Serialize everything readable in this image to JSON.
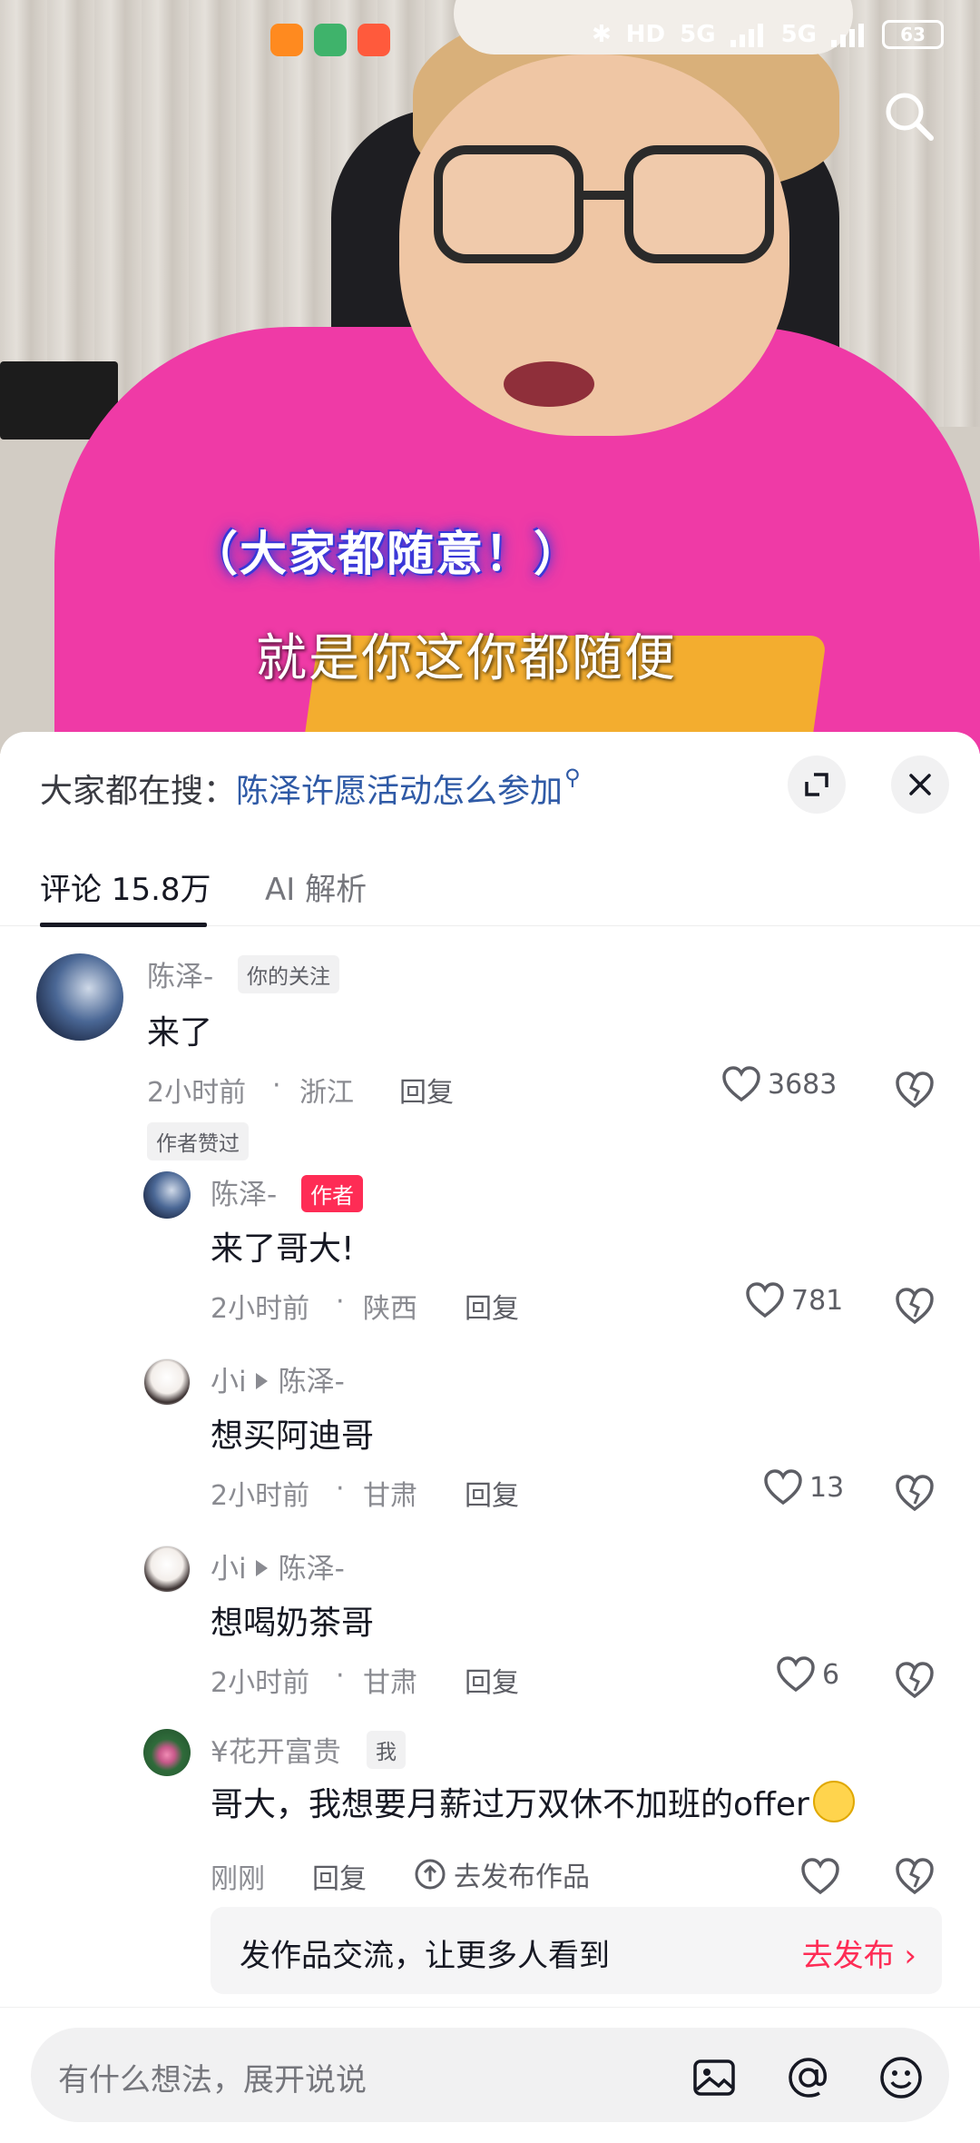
{
  "subtitles": {
    "line1": "（大家都随意！）",
    "line2": "就是你这你都随便"
  },
  "status_bar": {
    "battery": "63",
    "hd": "HD",
    "net1": "5G",
    "net2": "5G"
  },
  "suggest": {
    "label": "大家都在搜：",
    "query": "陈泽许愿活动怎么参加"
  },
  "tabs": {
    "comments": "评论 15.8万",
    "ai": "AI 解析"
  },
  "comments": [
    {
      "user": "陈泽-",
      "badge": "你的关注",
      "text": "来了",
      "time": "2小时前",
      "location": "浙江",
      "reply": "回复",
      "likes": "3683",
      "extra_tag": "作者赞过"
    },
    {
      "user": "陈泽-",
      "badge": "作者",
      "text": "来了哥大!",
      "time": "2小时前",
      "location": "陕西",
      "reply": "回复",
      "likes": "781"
    },
    {
      "user": "小i",
      "reply_to": "陈泽-",
      "text": "想买阿迪哥",
      "time": "2小时前",
      "location": "甘肃",
      "reply": "回复",
      "likes": "13"
    },
    {
      "user": "小i",
      "reply_to": "陈泽-",
      "text": "想喝奶茶哥",
      "time": "2小时前",
      "location": "甘肃",
      "reply": "回复",
      "likes": "6"
    },
    {
      "user": "¥花开富贵",
      "badge": "我",
      "text": "哥大，我想要月薪过万双休不加班的offer",
      "time": "刚刚",
      "reply": "回复",
      "publish": "去发布作品"
    }
  ],
  "meta_separator": "·",
  "promo": {
    "text": "发作品交流，让更多人看到",
    "cta": "去发布"
  },
  "input": {
    "placeholder": "有什么想法，展开说说"
  },
  "colors": {
    "accent": "#fe2c55",
    "link": "#2f5aa6"
  }
}
